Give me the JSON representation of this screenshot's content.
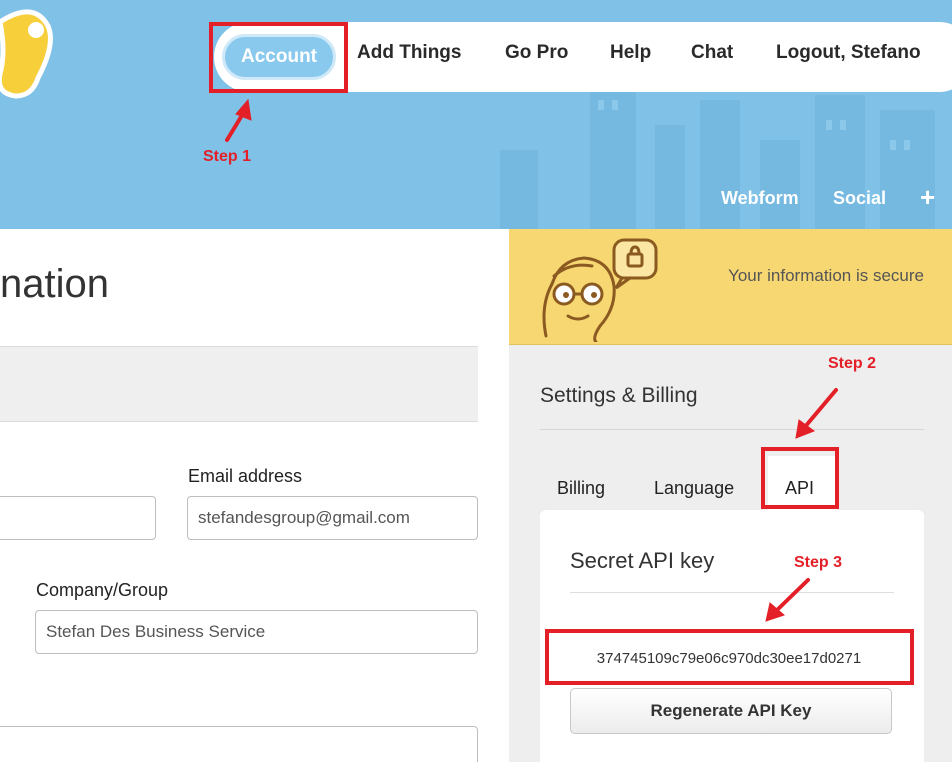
{
  "nav": {
    "account": "Account",
    "items": [
      "Add Things",
      "Go Pro",
      "Help",
      "Chat",
      "Logout, Stefano"
    ]
  },
  "subnav": {
    "items": [
      "Webform",
      "Social"
    ],
    "plus": "+"
  },
  "annotations": {
    "step1": "Step 1",
    "step2": "Step 2",
    "step3": "Step 3"
  },
  "main": {
    "title": "nation",
    "email_label": "Email address",
    "email_value": "stefandesgroup@gmail.com",
    "company_label": "Company/Group",
    "company_value": "Stefan Des Business Service"
  },
  "sidebar": {
    "secure_text": "Your information is secure",
    "title": "Settings & Billing",
    "tabs": [
      "Billing",
      "Language",
      "API"
    ],
    "api_title": "Secret API key",
    "api_key": "374745109c79e06c970dc30ee17d0271",
    "regenerate_label": "Regenerate API Key"
  },
  "colors": {
    "header_bg": "#7fc1e7",
    "annotation_red": "#e32028",
    "secure_bg": "#f7d772"
  }
}
